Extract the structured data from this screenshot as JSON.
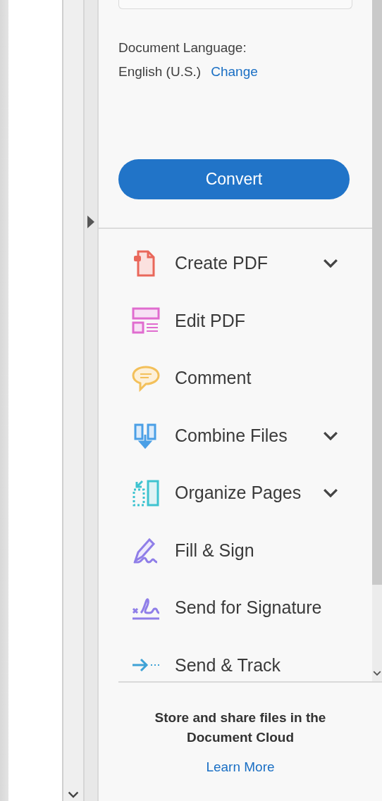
{
  "convert_panel": {
    "language_label": "Document Language:",
    "language_value": "English (U.S.)",
    "change_link": "Change",
    "convert_button": "Convert"
  },
  "tools": [
    {
      "kind": "create",
      "label": "Create PDF",
      "expandable": true
    },
    {
      "kind": "edit",
      "label": "Edit PDF",
      "expandable": false
    },
    {
      "kind": "comment",
      "label": "Comment",
      "expandable": false
    },
    {
      "kind": "combine",
      "label": "Combine Files",
      "expandable": true
    },
    {
      "kind": "organize",
      "label": "Organize Pages",
      "expandable": true
    },
    {
      "kind": "fill-sign",
      "label": "Fill & Sign",
      "expandable": false
    },
    {
      "kind": "send-signature",
      "label": "Send for Signature",
      "expandable": false
    },
    {
      "kind": "send-track",
      "label": "Send & Track",
      "expandable": false
    }
  ],
  "footer": {
    "message": "Store and share files in the Document Cloud",
    "link": "Learn More"
  }
}
